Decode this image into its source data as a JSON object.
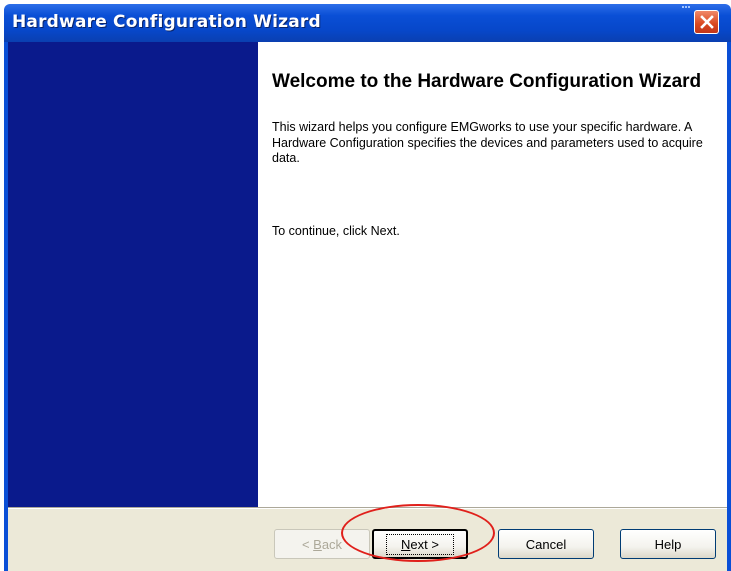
{
  "window": {
    "title": "Hardware Configuration Wizard"
  },
  "content": {
    "heading": "Welcome to the Hardware Configuration Wizard",
    "description": "This wizard helps you configure EMGworks to use your specific hardware. A Hardware Configuration specifies the devices and parameters used to acquire data.",
    "continue_text": "To continue, click Next."
  },
  "buttons": {
    "back": {
      "mnemonic": "B",
      "rest": "ack",
      "prefix": "< "
    },
    "next": {
      "mnemonic": "N",
      "rest": "ext >"
    },
    "cancel": "Cancel",
    "help": "Help"
  },
  "colors": {
    "titlebar": "#0a4fd6",
    "sidebar": "#0a1a8c",
    "dialog_face": "#ece9d8",
    "highlight_annotation": "#e0201b"
  },
  "icons": {
    "close": "close-icon"
  }
}
